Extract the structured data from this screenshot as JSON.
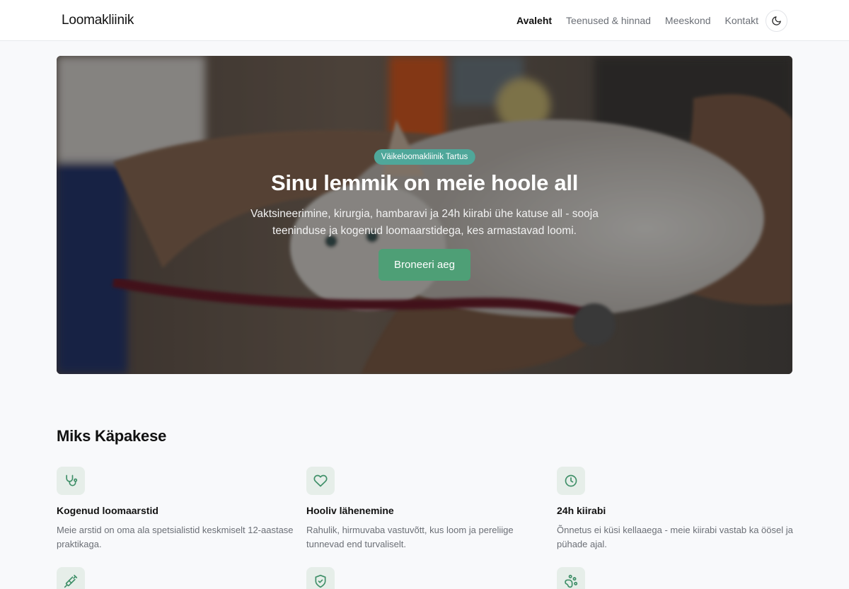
{
  "header": {
    "logo": "Loomakliinik",
    "nav": [
      {
        "label": "Avaleht",
        "active": true
      },
      {
        "label": "Teenused & hinnad",
        "active": false
      },
      {
        "label": "Meeskond",
        "active": false
      },
      {
        "label": "Kontakt",
        "active": false
      }
    ],
    "theme_toggle_icon": "moon-icon"
  },
  "hero": {
    "badge": "Väikeloomakliinik Tartus",
    "title": "Sinu lemmik on meie hoole all",
    "subtitle": "Vaktsineerimine, kirurgia, hambaravi ja 24h kiirabi ühe katuse all - sooja teeninduse ja kogenud loomaarstidega, kes armastavad loomi.",
    "cta": "Broneeri aeg"
  },
  "features": {
    "title": "Miks Käpakese",
    "items": [
      {
        "icon": "stethoscope-icon",
        "title": "Kogenud loomaarstid",
        "desc": "Meie arstid on oma ala spetsialistid keskmiselt 12-aastase praktikaga."
      },
      {
        "icon": "heart-icon",
        "title": "Hooliv lähenemine",
        "desc": "Rahulik, hirmuvaba vastuvõtt, kus loom ja pereliige tunnevad end turvaliselt."
      },
      {
        "icon": "clock-icon",
        "title": "24h kiirabi",
        "desc": "Õnnetus ei küsi kellaaega - meie kiirabi vastab ka öösel ja pühade ajal."
      },
      {
        "icon": "syringe-icon"
      },
      {
        "icon": "shield-check-icon"
      },
      {
        "icon": "paw-icon"
      }
    ]
  },
  "colors": {
    "accent": "#4e9f76",
    "badge": "#4fa79a",
    "icon_bg": "#e6eee9",
    "icon_stroke": "#3f8f68"
  }
}
